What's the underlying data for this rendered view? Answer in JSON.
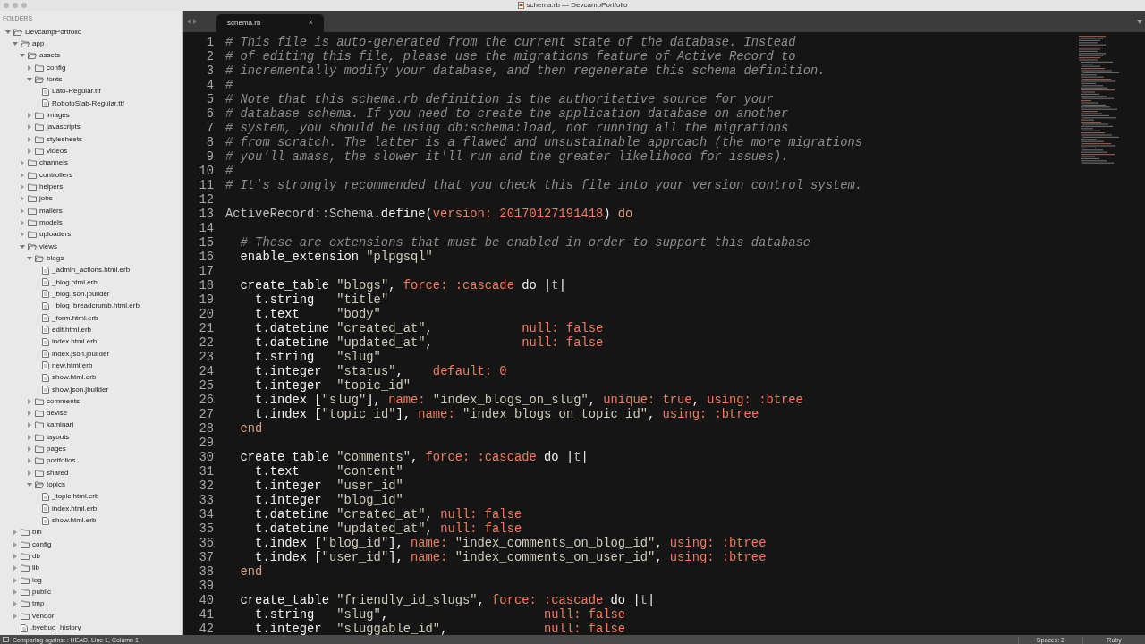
{
  "window": {
    "title": "schema.rb — DevcampPortfolio"
  },
  "sidebar": {
    "header": "FOLDERS",
    "tree": [
      {
        "kind": "folder",
        "name": "DevcampPortfolio",
        "expanded": true,
        "children": [
          {
            "kind": "folder",
            "name": "app",
            "expanded": true,
            "children": [
              {
                "kind": "folder",
                "name": "assets",
                "expanded": true,
                "children": [
                  {
                    "kind": "folder",
                    "name": "config",
                    "expanded": false
                  },
                  {
                    "kind": "folder",
                    "name": "fonts",
                    "expanded": true,
                    "children": [
                      {
                        "kind": "file",
                        "name": "Lato-Regular.ttf"
                      },
                      {
                        "kind": "file",
                        "name": "RobotoSlab-Regular.ttf"
                      }
                    ]
                  },
                  {
                    "kind": "folder",
                    "name": "images",
                    "expanded": false
                  },
                  {
                    "kind": "folder",
                    "name": "javascripts",
                    "expanded": false
                  },
                  {
                    "kind": "folder",
                    "name": "stylesheets",
                    "expanded": false
                  },
                  {
                    "kind": "folder",
                    "name": "videos",
                    "expanded": false
                  }
                ]
              },
              {
                "kind": "folder",
                "name": "channels",
                "expanded": false
              },
              {
                "kind": "folder",
                "name": "controllers",
                "expanded": false
              },
              {
                "kind": "folder",
                "name": "helpers",
                "expanded": false
              },
              {
                "kind": "folder",
                "name": "jobs",
                "expanded": false
              },
              {
                "kind": "folder",
                "name": "mailers",
                "expanded": false
              },
              {
                "kind": "folder",
                "name": "models",
                "expanded": false
              },
              {
                "kind": "folder",
                "name": "uploaders",
                "expanded": false
              },
              {
                "kind": "folder",
                "name": "views",
                "expanded": true,
                "children": [
                  {
                    "kind": "folder",
                    "name": "blogs",
                    "expanded": true,
                    "children": [
                      {
                        "kind": "file",
                        "name": "_admin_actions.html.erb"
                      },
                      {
                        "kind": "file",
                        "name": "_blog.html.erb"
                      },
                      {
                        "kind": "file",
                        "name": "_blog.json.jbuilder"
                      },
                      {
                        "kind": "file",
                        "name": "_blog_breadcrumb.html.erb"
                      },
                      {
                        "kind": "file",
                        "name": "_form.html.erb"
                      },
                      {
                        "kind": "file",
                        "name": "edit.html.erb"
                      },
                      {
                        "kind": "file",
                        "name": "index.html.erb"
                      },
                      {
                        "kind": "file",
                        "name": "index.json.jbuilder"
                      },
                      {
                        "kind": "file",
                        "name": "new.html.erb"
                      },
                      {
                        "kind": "file",
                        "name": "show.html.erb"
                      },
                      {
                        "kind": "file",
                        "name": "show.json.jbuilder"
                      }
                    ]
                  },
                  {
                    "kind": "folder",
                    "name": "comments",
                    "expanded": false
                  },
                  {
                    "kind": "folder",
                    "name": "devise",
                    "expanded": false
                  },
                  {
                    "kind": "folder",
                    "name": "kaminari",
                    "expanded": false
                  },
                  {
                    "kind": "folder",
                    "name": "layouts",
                    "expanded": false
                  },
                  {
                    "kind": "folder",
                    "name": "pages",
                    "expanded": false
                  },
                  {
                    "kind": "folder",
                    "name": "portfolios",
                    "expanded": false
                  },
                  {
                    "kind": "folder",
                    "name": "shared",
                    "expanded": false
                  },
                  {
                    "kind": "folder",
                    "name": "topics",
                    "expanded": true,
                    "children": [
                      {
                        "kind": "file",
                        "name": "_topic.html.erb"
                      },
                      {
                        "kind": "file",
                        "name": "index.html.erb"
                      },
                      {
                        "kind": "file",
                        "name": "show.html.erb"
                      }
                    ]
                  }
                ]
              }
            ]
          },
          {
            "kind": "folder",
            "name": "bin",
            "expanded": false
          },
          {
            "kind": "folder",
            "name": "config",
            "expanded": false
          },
          {
            "kind": "folder",
            "name": "db",
            "expanded": false
          },
          {
            "kind": "folder",
            "name": "lib",
            "expanded": false
          },
          {
            "kind": "folder",
            "name": "log",
            "expanded": false
          },
          {
            "kind": "folder",
            "name": "public",
            "expanded": false
          },
          {
            "kind": "folder",
            "name": "tmp",
            "expanded": false
          },
          {
            "kind": "folder",
            "name": "vendor",
            "expanded": false
          },
          {
            "kind": "file",
            "name": ".byebug_history"
          }
        ]
      }
    ]
  },
  "tabs": [
    {
      "label": "schema.rb",
      "close": "×",
      "selected": true
    }
  ],
  "editor": {
    "lines": [
      {
        "number": "1",
        "tokens": [
          {
            "kind": "comment",
            "text": "# This file is auto-generated from the current state of the database. Instead"
          }
        ]
      },
      {
        "number": "2",
        "tokens": [
          {
            "kind": "comment",
            "text": "# of editing this file, please use the migrations feature of Active Record to"
          }
        ]
      },
      {
        "number": "3",
        "tokens": [
          {
            "kind": "comment",
            "text": "# incrementally modify your database, and then regenerate this schema definition."
          }
        ]
      },
      {
        "number": "4",
        "tokens": [
          {
            "kind": "comment",
            "text": "#"
          }
        ]
      },
      {
        "number": "5",
        "tokens": [
          {
            "kind": "comment",
            "text": "# Note that this schema.rb definition is the authoritative source for your"
          }
        ]
      },
      {
        "number": "6",
        "tokens": [
          {
            "kind": "comment",
            "text": "# database schema. If you need to create the application database on another"
          }
        ]
      },
      {
        "number": "7",
        "tokens": [
          {
            "kind": "comment",
            "text": "# system, you should be using db:schema:load, not running all the migrations"
          }
        ]
      },
      {
        "number": "8",
        "tokens": [
          {
            "kind": "comment",
            "text": "# from scratch. The latter is a flawed and unsustainable approach (the more migrations"
          }
        ]
      },
      {
        "number": "9",
        "tokens": [
          {
            "kind": "comment",
            "text": "# you'll amass, the slower it'll run and the greater likelihood for issues)."
          }
        ]
      },
      {
        "number": "10",
        "tokens": [
          {
            "kind": "comment",
            "text": "#"
          }
        ]
      },
      {
        "number": "11",
        "tokens": [
          {
            "kind": "comment",
            "text": "# It's strongly recommended that you check this file into your version control system."
          }
        ]
      },
      {
        "number": "12"
      },
      {
        "number": "13",
        "tokens": [
          {
            "kind": "muted",
            "text": "ActiveRecord::Schema"
          },
          {
            "kind": "plain",
            "text": ".define("
          },
          {
            "kind": "key",
            "text": "version: 20170127191418"
          },
          {
            "kind": "plain",
            "text": ") "
          },
          {
            "kind": "keyword",
            "text": "do"
          }
        ]
      },
      {
        "number": "14"
      },
      {
        "number": "15",
        "tokens": [
          {
            "kind": "comment",
            "text": "  # These are extensions that must be enabled in order to support this database"
          }
        ]
      },
      {
        "number": "16",
        "tokens": [
          {
            "kind": "plain",
            "text": "  enable_extension "
          },
          {
            "kind": "string",
            "text": "\"plpgsql\""
          }
        ]
      },
      {
        "number": "17"
      },
      {
        "number": "18",
        "tokens": [
          {
            "kind": "plain",
            "text": "  create_table "
          },
          {
            "kind": "string",
            "text": "\"blogs\""
          },
          {
            "kind": "plain",
            "text": ", "
          },
          {
            "kind": "key",
            "text": "force: :cascade"
          },
          {
            "kind": "plain",
            "text": " do |"
          },
          {
            "kind": "muted",
            "text": "t"
          },
          {
            "kind": "plain",
            "text": "|"
          }
        ]
      },
      {
        "number": "19",
        "tokens": [
          {
            "kind": "plain",
            "text": "    t.string   "
          },
          {
            "kind": "string",
            "text": "\"title\""
          }
        ]
      },
      {
        "number": "20",
        "tokens": [
          {
            "kind": "plain",
            "text": "    t.text     "
          },
          {
            "kind": "string",
            "text": "\"body\""
          }
        ]
      },
      {
        "number": "21",
        "tokens": [
          {
            "kind": "plain",
            "text": "    t.datetime "
          },
          {
            "kind": "string",
            "text": "\"created_at\""
          },
          {
            "kind": "plain",
            "text": ",            "
          },
          {
            "kind": "key",
            "text": "null: false"
          }
        ]
      },
      {
        "number": "22",
        "tokens": [
          {
            "kind": "plain",
            "text": "    t.datetime "
          },
          {
            "kind": "string",
            "text": "\"updated_at\""
          },
          {
            "kind": "plain",
            "text": ",            "
          },
          {
            "kind": "key",
            "text": "null: false"
          }
        ]
      },
      {
        "number": "23",
        "tokens": [
          {
            "kind": "plain",
            "text": "    t.string   "
          },
          {
            "kind": "string",
            "text": "\"slug\""
          }
        ]
      },
      {
        "number": "24",
        "tokens": [
          {
            "kind": "plain",
            "text": "    t.integer  "
          },
          {
            "kind": "string",
            "text": "\"status\""
          },
          {
            "kind": "plain",
            "text": ",    "
          },
          {
            "kind": "key",
            "text": "default: 0"
          }
        ]
      },
      {
        "number": "25",
        "tokens": [
          {
            "kind": "plain",
            "text": "    t.integer  "
          },
          {
            "kind": "string",
            "text": "\"topic_id\""
          }
        ]
      },
      {
        "number": "26",
        "tokens": [
          {
            "kind": "plain",
            "text": "    t.index ["
          },
          {
            "kind": "string",
            "text": "\"slug\""
          },
          {
            "kind": "plain",
            "text": "], "
          },
          {
            "kind": "key",
            "text": "name: "
          },
          {
            "kind": "string",
            "text": "\"index_blogs_on_slug\""
          },
          {
            "kind": "plain",
            "text": ", "
          },
          {
            "kind": "key",
            "text": "unique: true"
          },
          {
            "kind": "plain",
            "text": ", "
          },
          {
            "kind": "key",
            "text": "using: :btree"
          }
        ]
      },
      {
        "number": "27",
        "tokens": [
          {
            "kind": "plain",
            "text": "    t.index ["
          },
          {
            "kind": "string",
            "text": "\"topic_id\""
          },
          {
            "kind": "plain",
            "text": "], "
          },
          {
            "kind": "key",
            "text": "name: "
          },
          {
            "kind": "string",
            "text": "\"index_blogs_on_topic_id\""
          },
          {
            "kind": "plain",
            "text": ", "
          },
          {
            "kind": "key",
            "text": "using: :btree"
          }
        ]
      },
      {
        "number": "28",
        "tokens": [
          {
            "kind": "keyword",
            "text": "  end"
          }
        ]
      },
      {
        "number": "29"
      },
      {
        "number": "30",
        "tokens": [
          {
            "kind": "plain",
            "text": "  create_table "
          },
          {
            "kind": "string",
            "text": "\"comments\""
          },
          {
            "kind": "plain",
            "text": ", "
          },
          {
            "kind": "key",
            "text": "force: :cascade"
          },
          {
            "kind": "plain",
            "text": " do |"
          },
          {
            "kind": "muted",
            "text": "t"
          },
          {
            "kind": "plain",
            "text": "|"
          }
        ]
      },
      {
        "number": "31",
        "tokens": [
          {
            "kind": "plain",
            "text": "    t.text     "
          },
          {
            "kind": "string",
            "text": "\"content\""
          }
        ]
      },
      {
        "number": "32",
        "tokens": [
          {
            "kind": "plain",
            "text": "    t.integer  "
          },
          {
            "kind": "string",
            "text": "\"user_id\""
          }
        ]
      },
      {
        "number": "33",
        "tokens": [
          {
            "kind": "plain",
            "text": "    t.integer  "
          },
          {
            "kind": "string",
            "text": "\"blog_id\""
          }
        ]
      },
      {
        "number": "34",
        "tokens": [
          {
            "kind": "plain",
            "text": "    t.datetime "
          },
          {
            "kind": "string",
            "text": "\"created_at\""
          },
          {
            "kind": "plain",
            "text": ", "
          },
          {
            "kind": "key",
            "text": "null: false"
          }
        ]
      },
      {
        "number": "35",
        "tokens": [
          {
            "kind": "plain",
            "text": "    t.datetime "
          },
          {
            "kind": "string",
            "text": "\"updated_at\""
          },
          {
            "kind": "plain",
            "text": ", "
          },
          {
            "kind": "key",
            "text": "null: false"
          }
        ]
      },
      {
        "number": "36",
        "tokens": [
          {
            "kind": "plain",
            "text": "    t.index ["
          },
          {
            "kind": "string",
            "text": "\"blog_id\""
          },
          {
            "kind": "plain",
            "text": "], "
          },
          {
            "kind": "key",
            "text": "name: "
          },
          {
            "kind": "string",
            "text": "\"index_comments_on_blog_id\""
          },
          {
            "kind": "plain",
            "text": ", "
          },
          {
            "kind": "key",
            "text": "using: :btree"
          }
        ]
      },
      {
        "number": "37",
        "tokens": [
          {
            "kind": "plain",
            "text": "    t.index ["
          },
          {
            "kind": "string",
            "text": "\"user_id\""
          },
          {
            "kind": "plain",
            "text": "], "
          },
          {
            "kind": "key",
            "text": "name: "
          },
          {
            "kind": "string",
            "text": "\"index_comments_on_user_id\""
          },
          {
            "kind": "plain",
            "text": ", "
          },
          {
            "kind": "key",
            "text": "using: :btree"
          }
        ]
      },
      {
        "number": "38",
        "tokens": [
          {
            "kind": "keyword",
            "text": "  end"
          }
        ]
      },
      {
        "number": "39"
      },
      {
        "number": "40",
        "tokens": [
          {
            "kind": "plain",
            "text": "  create_table "
          },
          {
            "kind": "string",
            "text": "\"friendly_id_slugs\""
          },
          {
            "kind": "plain",
            "text": ", "
          },
          {
            "kind": "key",
            "text": "force: :cascade"
          },
          {
            "kind": "plain",
            "text": " do |"
          },
          {
            "kind": "muted",
            "text": "t"
          },
          {
            "kind": "plain",
            "text": "|"
          }
        ]
      },
      {
        "number": "41",
        "tokens": [
          {
            "kind": "plain",
            "text": "    t.string   "
          },
          {
            "kind": "string",
            "text": "\"slug\""
          },
          {
            "kind": "plain",
            "text": ",                     "
          },
          {
            "kind": "key",
            "text": "null: false"
          }
        ]
      },
      {
        "number": "42",
        "tokens": [
          {
            "kind": "plain",
            "text": "    t.integer  "
          },
          {
            "kind": "string",
            "text": "\"sluggable_id\""
          },
          {
            "kind": "plain",
            "text": ",             "
          },
          {
            "kind": "key",
            "text": "null: false"
          }
        ]
      }
    ]
  },
  "status_bar": {
    "left": "Comparing against : HEAD, Line 1, Column 1",
    "indentation": "Spaces: 2",
    "syntax": "Ruby"
  }
}
